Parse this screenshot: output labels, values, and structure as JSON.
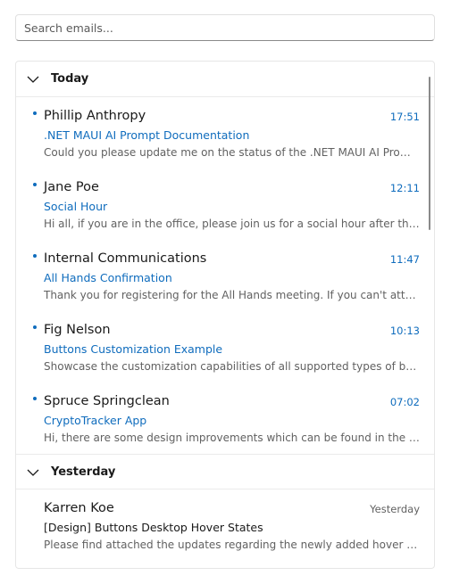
{
  "search": {
    "placeholder": "Search emails..."
  },
  "groups": [
    {
      "title": "Today",
      "emails": [
        {
          "sender": "Phillip Anthropy",
          "time": "17:51",
          "subject": ".NET MAUI AI Prompt Documentation",
          "preview": "Could you please update me on the status of the .NET MAUI AI Prompt Documentation?",
          "unread": true
        },
        {
          "sender": "Jane Poe",
          "time": "12:11",
          "subject": "Social Hour",
          "preview": "Hi all, if you are in the office, please join us for a social hour after the meeting.",
          "unread": true
        },
        {
          "sender": "Internal Communications",
          "time": "11:47",
          "subject": "All Hands Confirmation",
          "preview": "Thank you for registering for the All Hands meeting. If you can't attend, let us know.",
          "unread": true
        },
        {
          "sender": "Fig Nelson",
          "time": "10:13",
          "subject": "Buttons Customization Example",
          "preview": "Showcase the customization capabilities of all supported types of buttons.",
          "unread": true
        },
        {
          "sender": "Spruce Springclean",
          "time": "07:02",
          "subject": "CryptoTracker App",
          "preview": "Hi, there are some design improvements which can be found in the attached file.",
          "unread": true
        }
      ]
    },
    {
      "title": "Yesterday",
      "emails": [
        {
          "sender": "Karren Koe",
          "time": "Yesterday",
          "subject": "[Design] Buttons Desktop Hover States",
          "preview": "Please find attached the updates regarding the newly added hover states.",
          "unread": false
        }
      ]
    }
  ],
  "colors": {
    "accent": "#0f6cbd",
    "muted": "#616161",
    "text": "#1a1a1a"
  }
}
